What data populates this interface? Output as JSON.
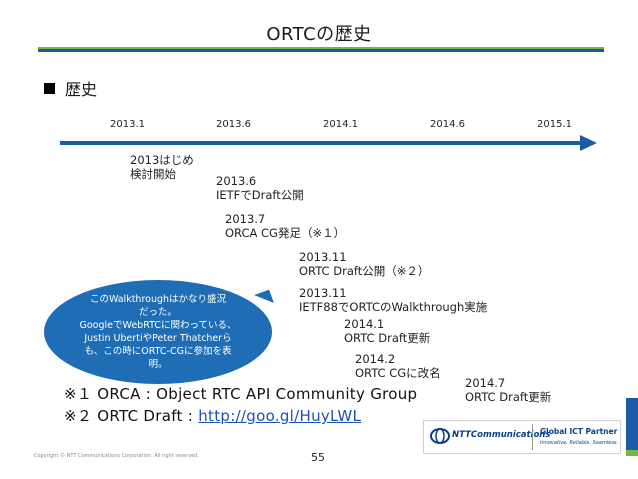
{
  "slide": {
    "title": "ORTCの歴史",
    "section_heading": "歴史",
    "page_number": "55",
    "copyright": "Copyright © NTT Communications Corporation. All right reserved."
  },
  "timeline": {
    "ticks": [
      "2013.1",
      "2013.6",
      "2014.1",
      "2014.6",
      "2015.1"
    ],
    "events": [
      {
        "line1": "2013はじめ",
        "line2": "検討開始"
      },
      {
        "line1": "2013.6",
        "line2": "IETFでDraft公開"
      },
      {
        "line1": "2013.7",
        "line2": "ORCA CG発足（※１）"
      },
      {
        "line1": "2013.11",
        "line2": "ORTC Draft公開（※２）"
      },
      {
        "line1": "2013.11",
        "line2": "IETF88でORTCのWalkthrough実施"
      },
      {
        "line1": "2014.1",
        "line2": "ORTC Draft更新"
      },
      {
        "line1": "2014.2",
        "line2": "ORTC CGに改名"
      },
      {
        "line1": "2014.7",
        "line2": "ORTC Draft更新"
      }
    ]
  },
  "callout": {
    "lines": [
      "このWalkthroughはかなり盛況",
      "だった。",
      "GoogleでWebRTCに関わっている、",
      "Justin UbertiやPeter Thatcherら",
      "も、この時にORTC-CGに参加を表",
      "明。"
    ]
  },
  "notes": [
    {
      "mark": "※１",
      "text": "ORCA : Object RTC API Community Group",
      "link": ""
    },
    {
      "mark": "※２",
      "text": "ORTC Draft : ",
      "link": "http://goo.gl/HuyLWL"
    }
  ],
  "logo": {
    "company": "NTTCommunications",
    "tagline": "Global ICT Partner",
    "subtagline": "Innovative. Reliable. Seamless."
  },
  "colors": {
    "accent_blue": "#1b5aa6",
    "accent_green": "#78b548",
    "callout_blue": "#1e6db5",
    "link_blue": "#1f4fb8"
  },
  "icons": {
    "section_bullet": "square-bullet-icon",
    "timeline": "arrow-right-icon",
    "logo_mark": "ntt-logo-icon"
  }
}
